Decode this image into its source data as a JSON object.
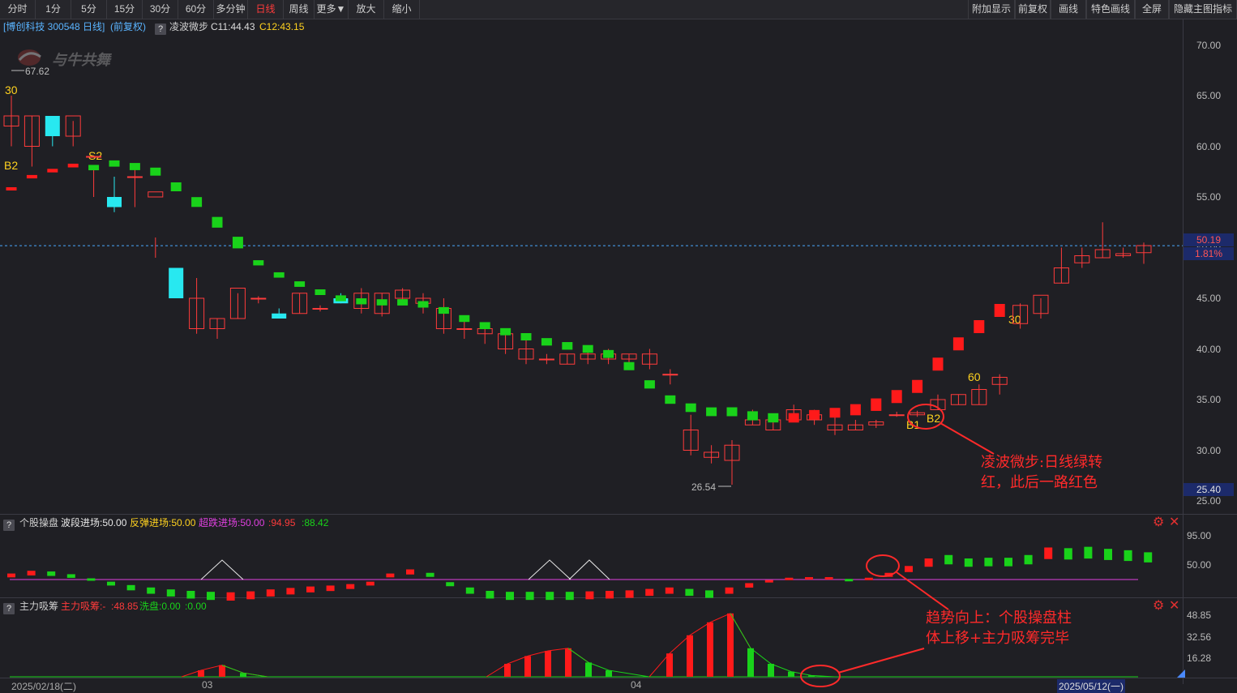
{
  "toolbar": {
    "periods": [
      "分时",
      "1分",
      "5分",
      "15分",
      "30分",
      "60分",
      "多分钟",
      "日线",
      "周线",
      "更多▼",
      "放大",
      "缩小"
    ],
    "active": "日线",
    "right": [
      "附加显示",
      "前复权",
      "画线",
      "特色画线",
      "全屏",
      "隐藏主图指标"
    ]
  },
  "info": {
    "stock": "[博创科技 300548 日线]",
    "adjust": "(前复权)",
    "q": "?",
    "indicator_name": "凌波微步",
    "c1": "C11:44.43",
    "c2": "C12:43.15"
  },
  "watermark": "与牛共舞",
  "price_axis": [
    "70.00",
    "65.00",
    "60.00",
    "55.00",
    "50.00",
    "45.00",
    "40.00",
    "35.00",
    "30.00",
    "25.00"
  ],
  "current_price": "50.19",
  "current_pct": "1.81%",
  "low_price_badge": "25.40",
  "high_marker": "67.62",
  "low_marker": "26.54",
  "tags": {
    "t30a": "30",
    "b2a": "B2",
    "s2": "S2",
    "t60": "60",
    "t30b": "30",
    "b1": "B1",
    "b2b": "B2"
  },
  "panel2": {
    "q": "?",
    "name": "个股操盘",
    "f1": "波段进场:50.00",
    "f2": "反弹进场:50.00",
    "f3": "超跌进场:50.00",
    "f4": ":94.95",
    "f5": ":88.42",
    "axis": [
      "95.00",
      "50.00"
    ]
  },
  "panel3": {
    "q": "?",
    "name": "主力吸筹",
    "f1": "主力吸筹:-",
    "f2": ":48.85",
    "f3": "洗盘:0.00",
    "f4": ":0.00",
    "axis": [
      "48.85",
      "32.56",
      "16.28"
    ]
  },
  "dates": {
    "d1": "2025/02/18(二)",
    "d2": "03",
    "d3": "04",
    "d4": "2025/05/12(一)"
  },
  "annotations": {
    "a1_l1": "凌波微步:日线绿转",
    "a1_l2": "红，此后一路红色",
    "a2_l1": "趋势向上：个股操盘柱",
    "a2_l2": "体上移+主力吸筹完毕"
  },
  "colors": {
    "up": "#ff3b3b",
    "down": "#28e8f0",
    "green": "#19d21a",
    "red": "#ff1a1a",
    "magenta": "#e040e0",
    "accent_red": "#ff2a2a",
    "yellow": "#ffd21f"
  },
  "chart_data": {
    "type": "candlestick",
    "ylim": [
      25,
      71
    ],
    "candles": [
      [
        62,
        65,
        60,
        63
      ],
      [
        60,
        63,
        58,
        63
      ],
      [
        63,
        62.5,
        60,
        61
      ],
      [
        61,
        62.5,
        60,
        63
      ],
      [
        59,
        58,
        55,
        59
      ],
      [
        55,
        57,
        53.5,
        54
      ],
      [
        57,
        58,
        54,
        57
      ],
      [
        55,
        51,
        49,
        55.5
      ],
      [
        48,
        47,
        45,
        45
      ],
      [
        42,
        47,
        41.5,
        45
      ],
      [
        42,
        43,
        41,
        43
      ],
      [
        43,
        45.5,
        43,
        46
      ],
      [
        45,
        45.2,
        44.5,
        45
      ],
      [
        43.5,
        44,
        43,
        43
      ],
      [
        43.5,
        45.5,
        43.5,
        45.5
      ],
      [
        44,
        44.3,
        43.7,
        44
      ],
      [
        45,
        45.5,
        44.5,
        44.5
      ],
      [
        44,
        46,
        43.5,
        45.5
      ],
      [
        43.5,
        45.5,
        43.2,
        45.5
      ],
      [
        45,
        46,
        44.5,
        45.8
      ],
      [
        44.5,
        45.5,
        43.5,
        45
      ],
      [
        42,
        45,
        41.5,
        44
      ],
      [
        42,
        43,
        41,
        42
      ],
      [
        41.5,
        42.5,
        40.5,
        42
      ],
      [
        40,
        41.5,
        39.5,
        41.5
      ],
      [
        39,
        41,
        38.5,
        40
      ],
      [
        39,
        39.5,
        38.5,
        39
      ],
      [
        38.5,
        39.5,
        38.5,
        39.5
      ],
      [
        39,
        40,
        38.5,
        39.5
      ],
      [
        39,
        40,
        38.5,
        39.5
      ],
      [
        39,
        39.5,
        38.5,
        39.5
      ],
      [
        38.5,
        40,
        38,
        39.5
      ],
      [
        37.5,
        38,
        36.5,
        37.5
      ],
      [
        30,
        33.5,
        29.5,
        32
      ],
      [
        29.3,
        30.5,
        28.7,
        29.8
      ],
      [
        29,
        31,
        26.6,
        30.5
      ],
      [
        32.5,
        34,
        32.5,
        33
      ],
      [
        32,
        33,
        32,
        33
      ],
      [
        33,
        34.5,
        33,
        34
      ],
      [
        33,
        34,
        32.5,
        33.5
      ],
      [
        32,
        33.5,
        31.5,
        32.5
      ],
      [
        32,
        33,
        32,
        32.5
      ],
      [
        32.5,
        33,
        32.2,
        32.8
      ],
      [
        33.5,
        33.8,
        33.3,
        33.5
      ],
      [
        33.5,
        33.9,
        33.3,
        33.7
      ],
      [
        34,
        35.5,
        34,
        35
      ],
      [
        34.5,
        35.5,
        34.5,
        35.5
      ],
      [
        34.5,
        36.5,
        34.5,
        36
      ],
      [
        36.5,
        37.5,
        35.5,
        37.2
      ],
      [
        42.5,
        44.5,
        42,
        44.3
      ],
      [
        43.5,
        45,
        43,
        45.3
      ],
      [
        46.5,
        50,
        46.5,
        48
      ],
      [
        48.5,
        50,
        48,
        49.2
      ],
      [
        49,
        52.5,
        49,
        49.8
      ],
      [
        49.2,
        50,
        49,
        49.4
      ],
      [
        49.5,
        50.5,
        48.4,
        50.2
      ]
    ],
    "indicator_bars": [
      [
        55.8,
        "r"
      ],
      [
        57,
        "r"
      ],
      [
        57.6,
        "r"
      ],
      [
        58.1,
        "r"
      ],
      [
        57.9,
        "g"
      ],
      [
        58.3,
        "g"
      ],
      [
        58.0,
        "g"
      ],
      [
        57.5,
        "g"
      ],
      [
        56.0,
        "g"
      ],
      [
        54.5,
        "g"
      ],
      [
        52.5,
        "g"
      ],
      [
        50.5,
        "g"
      ],
      [
        48.5,
        "g"
      ],
      [
        47.3,
        "g"
      ],
      [
        46.4,
        "g"
      ],
      [
        45.6,
        "g"
      ],
      [
        45.0,
        "g"
      ],
      [
        44.7,
        "g"
      ],
      [
        44.6,
        "g"
      ],
      [
        44.6,
        "g"
      ],
      [
        44.4,
        "g"
      ],
      [
        43.8,
        "g"
      ],
      [
        43.0,
        "g"
      ],
      [
        42.3,
        "g"
      ],
      [
        41.7,
        "g"
      ],
      [
        41.2,
        "g"
      ],
      [
        40.7,
        "g"
      ],
      [
        40.3,
        "g"
      ],
      [
        40.0,
        "g"
      ],
      [
        39.5,
        "g"
      ],
      [
        38.3,
        "g"
      ],
      [
        36.5,
        "g"
      ],
      [
        35.0,
        "g"
      ],
      [
        34.2,
        "g"
      ],
      [
        33.8,
        "g"
      ],
      [
        33.8,
        "g"
      ],
      [
        33.4,
        "g"
      ],
      [
        33.2,
        "g"
      ],
      [
        33.2,
        "r"
      ],
      [
        33.5,
        "r"
      ],
      [
        33.7,
        "r"
      ],
      [
        34.0,
        "r"
      ],
      [
        34.5,
        "r"
      ],
      [
        35.3,
        "r"
      ],
      [
        36.3,
        "r"
      ],
      [
        38.5,
        "r"
      ],
      [
        40.5,
        "r"
      ],
      [
        42.2,
        "r"
      ],
      [
        43.8,
        "r"
      ]
    ]
  }
}
